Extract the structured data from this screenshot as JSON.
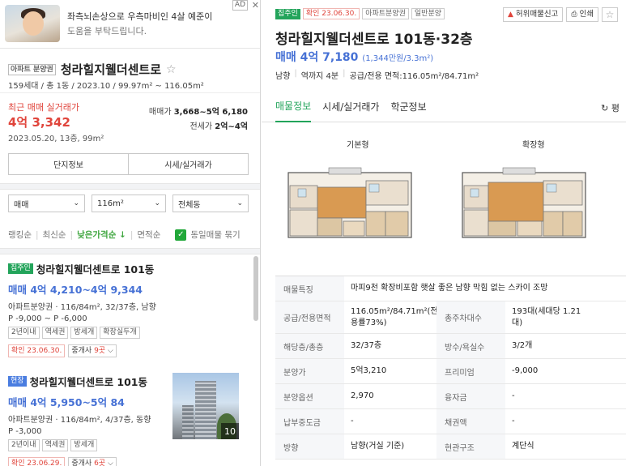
{
  "ad": {
    "badge": "AD",
    "close": "✕",
    "line1": "좌측뇌손상으로 우측마비인 4살 예준이",
    "line2": "도움을 부탁드립니다."
  },
  "complex": {
    "badge": "아파트 분양권",
    "name": "청라힐지웰더센트로",
    "star": "☆",
    "sub": "159세대 / 총 1동 / 2023.10 / 99.97m² ~ 116.05m²",
    "recent_label": "최근 매매 실거래가",
    "recent_price": "4억 3,342",
    "recent_date": "2023.05.20, 13층, 99m²",
    "sale_label": "매매가",
    "sale_value": "3,668~5억 6,180",
    "lease_label": "전세가",
    "lease_value": "2억~4억",
    "btn_info": "단지정보",
    "btn_price": "시세/실거래가"
  },
  "filters": {
    "type": "매매",
    "area": "116m²",
    "dong": "전체동"
  },
  "sorts": {
    "ranking": "랭킹순",
    "latest": "최신순",
    "low_price": "낮은가격순 ↓",
    "area": "면적순",
    "same_listing": "동일매물 묶기"
  },
  "listings": [
    {
      "tag": "집주인",
      "title": "청라힐지웰더센트로 101동",
      "price": "매매 4억 4,210~4억 9,344",
      "desc": "아파트분양권 · 116/84m², 32/37층, 남향",
      "range": "P -9,000 ~ P -6,000",
      "chips": [
        "2년이내",
        "역세권",
        "방세개",
        "확장실두개"
      ],
      "confirm": "확인 23.06.30.",
      "agent_prefix": "중개사 ",
      "agent_count": "9곳",
      "agent_suffix": " ⌵"
    },
    {
      "tag": "현장",
      "title": "청라힐지웰더센트로 101동",
      "price": "매매 4억 5,950~5억 84",
      "desc": "아파트분양권 · 116/84m², 4/37층, 동향",
      "range": "P -3,000",
      "chips": [
        "2년이내",
        "역세권",
        "방세개"
      ],
      "confirm": "확인 23.06.29.",
      "agent_prefix": "중개사 ",
      "agent_count": "6곳",
      "agent_suffix": " ⌵",
      "photo_count": "10"
    }
  ],
  "detail": {
    "tags": [
      "집주인",
      "확인 23.06.30.",
      "아파트분양권",
      "일반분양"
    ],
    "report": "허위매물신고",
    "print": "인쇄",
    "title": "청라힐지웰더센트로 101동·32층",
    "price": "매매 4억 7,180",
    "price_unit": "(1,344만원/3.3m²)",
    "info": [
      "남향",
      "역까지 4분",
      "공급/전용 면적:116.05m²/84.71m²"
    ],
    "tabs": [
      "매물정보",
      "시세/실거래가",
      "학군정보"
    ],
    "refresh": "↻ 평",
    "fp_basic": "기본형",
    "fp_ext": "확장형",
    "rows": [
      {
        "k1": "매물특징",
        "v1": "마피9천 확장비포함 햇살 좋은 남향 막힘 없는 스카이 조망"
      },
      {
        "k1": "공급/전용면적",
        "v1": "116.05m²/84.71m²(전용률73%)",
        "k2": "총주차대수",
        "v2": "193대(세대당 1.21대)"
      },
      {
        "k1": "해당층/총층",
        "v1": "32/37층",
        "k2": "방수/욕실수",
        "v2": "3/2개"
      },
      {
        "k1": "분양가",
        "v1": "5억3,210",
        "k2": "프리미엄",
        "v2": "-9,000"
      },
      {
        "k1": "분양옵션",
        "v1": "2,970",
        "k2": "융자금",
        "v2": "-"
      },
      {
        "k1": "납부중도금",
        "v1": "-",
        "k2": "채권액",
        "v2": "-"
      },
      {
        "k1": "방향",
        "v1": "남향(거실 기준)",
        "k2": "현관구조",
        "v2": "계단식"
      }
    ]
  }
}
